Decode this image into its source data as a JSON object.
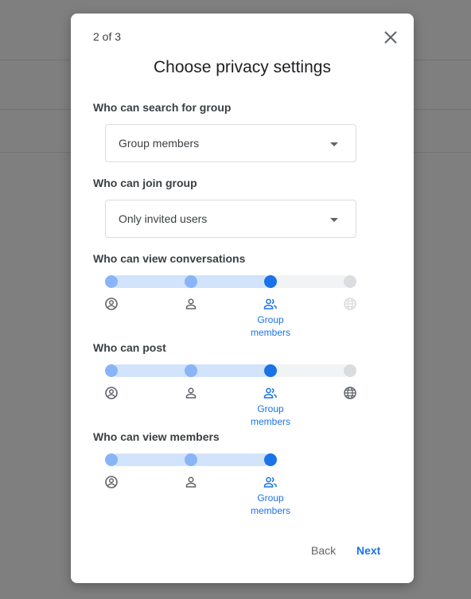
{
  "dialog": {
    "step": "2 of 3",
    "title": "Choose privacy settings",
    "back_label": "Back",
    "next_label": "Next"
  },
  "search": {
    "label": "Who can search for group",
    "value": "Group members"
  },
  "join": {
    "label": "Who can join group",
    "value": "Only invited users"
  },
  "conversations": {
    "label": "Who can view conversations",
    "selected_label": "Group members",
    "levels": [
      "owner",
      "manager",
      "group-members",
      "public"
    ],
    "selected_index": 2,
    "disabled_index": 3
  },
  "post": {
    "label": "Who can post",
    "selected_label": "Group members",
    "levels": [
      "owner",
      "manager",
      "group-members",
      "public"
    ],
    "selected_index": 2
  },
  "members": {
    "label": "Who can view members",
    "selected_label": "Group members",
    "levels": [
      "owner",
      "manager",
      "group-members"
    ],
    "selected_index": 2
  },
  "colors": {
    "accent": "#1a73e8",
    "knob_light": "#8ab4f8",
    "fill": "#d2e3fc",
    "overlay": "#7f7f7f"
  }
}
